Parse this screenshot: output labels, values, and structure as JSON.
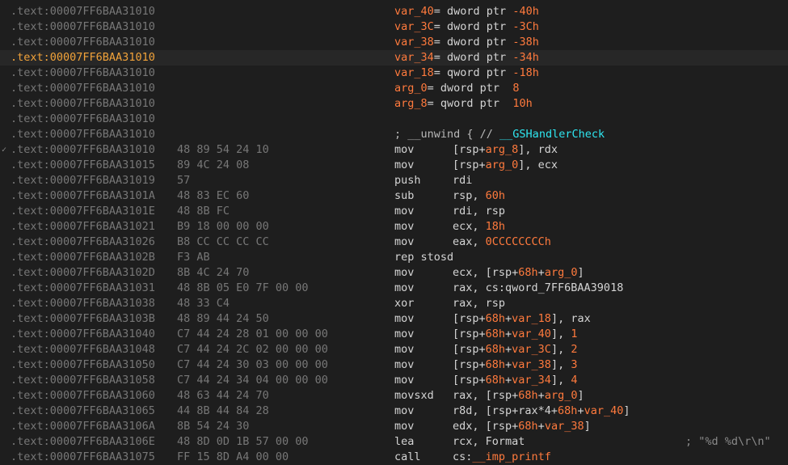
{
  "theme": {
    "background": "#1e1e1e",
    "highlight": "#f2a33a",
    "variable": "#ff7a3d",
    "function": "#2ee6f0"
  },
  "rows": [
    {
      "seg": ".text:",
      "addr": "00007FF6BAA31010",
      "bytes": "",
      "parts": [
        {
          "t": "var_40",
          "c": "var"
        },
        {
          "t": "= dword ptr ",
          "c": "kw"
        },
        {
          "t": "-40h",
          "c": "num"
        }
      ]
    },
    {
      "seg": ".text:",
      "addr": "00007FF6BAA31010",
      "bytes": "",
      "parts": [
        {
          "t": "var_3C",
          "c": "var"
        },
        {
          "t": "= dword ptr ",
          "c": "kw"
        },
        {
          "t": "-3Ch",
          "c": "num"
        }
      ]
    },
    {
      "seg": ".text:",
      "addr": "00007FF6BAA31010",
      "bytes": "",
      "parts": [
        {
          "t": "var_38",
          "c": "var"
        },
        {
          "t": "= dword ptr ",
          "c": "kw"
        },
        {
          "t": "-38h",
          "c": "num"
        }
      ]
    },
    {
      "seg": ".text:",
      "addr": "00007FF6BAA31010",
      "bytes": "",
      "hl": true,
      "parts": [
        {
          "t": "var_34",
          "c": "var"
        },
        {
          "t": "= dword ptr ",
          "c": "kw"
        },
        {
          "t": "-34h",
          "c": "num"
        }
      ]
    },
    {
      "seg": ".text:",
      "addr": "00007FF6BAA31010",
      "bytes": "",
      "parts": [
        {
          "t": "var_18",
          "c": "var"
        },
        {
          "t": "= qword ptr ",
          "c": "kw"
        },
        {
          "t": "-18h",
          "c": "num"
        }
      ]
    },
    {
      "seg": ".text:",
      "addr": "00007FF6BAA31010",
      "bytes": "",
      "parts": [
        {
          "t": "arg_0",
          "c": "var"
        },
        {
          "t": "= dword ptr  ",
          "c": "kw"
        },
        {
          "t": "8",
          "c": "num"
        }
      ]
    },
    {
      "seg": ".text:",
      "addr": "00007FF6BAA31010",
      "bytes": "",
      "parts": [
        {
          "t": "arg_8",
          "c": "var"
        },
        {
          "t": "= qword ptr  ",
          "c": "kw"
        },
        {
          "t": "10h",
          "c": "num"
        }
      ]
    },
    {
      "seg": ".text:",
      "addr": "00007FF6BAA31010",
      "bytes": "",
      "parts": []
    },
    {
      "seg": ".text:",
      "addr": "00007FF6BAA31010",
      "bytes": "",
      "parts": [
        {
          "t": "; __unwind { // ",
          "c": "cmt"
        },
        {
          "t": "__GSHandlerCheck",
          "c": "fn"
        }
      ]
    },
    {
      "seg": ".text:",
      "addr": "00007FF6BAA31010",
      "bytes": "48 89 54 24 10",
      "arrow": true,
      "mn": "mov",
      "op": [
        {
          "t": "[rsp+",
          "c": "kw"
        },
        {
          "t": "arg_8",
          "c": "var"
        },
        {
          "t": "], rdx",
          "c": "kw"
        }
      ]
    },
    {
      "seg": ".text:",
      "addr": "00007FF6BAA31015",
      "bytes": "89 4C 24 08",
      "mn": "mov",
      "op": [
        {
          "t": "[rsp+",
          "c": "kw"
        },
        {
          "t": "arg_0",
          "c": "var"
        },
        {
          "t": "], ecx",
          "c": "kw"
        }
      ]
    },
    {
      "seg": ".text:",
      "addr": "00007FF6BAA31019",
      "bytes": "57",
      "mn": "push",
      "op": [
        {
          "t": "rdi",
          "c": "kw"
        }
      ]
    },
    {
      "seg": ".text:",
      "addr": "00007FF6BAA3101A",
      "bytes": "48 83 EC 60",
      "mn": "sub",
      "op": [
        {
          "t": "rsp, ",
          "c": "kw"
        },
        {
          "t": "60h",
          "c": "num"
        }
      ]
    },
    {
      "seg": ".text:",
      "addr": "00007FF6BAA3101E",
      "bytes": "48 8B FC",
      "mn": "mov",
      "op": [
        {
          "t": "rdi, rsp",
          "c": "kw"
        }
      ]
    },
    {
      "seg": ".text:",
      "addr": "00007FF6BAA31021",
      "bytes": "B9 18 00 00 00",
      "mn": "mov",
      "op": [
        {
          "t": "ecx, ",
          "c": "kw"
        },
        {
          "t": "18h",
          "c": "num"
        }
      ]
    },
    {
      "seg": ".text:",
      "addr": "00007FF6BAA31026",
      "bytes": "B8 CC CC CC CC",
      "mn": "mov",
      "op": [
        {
          "t": "eax, ",
          "c": "kw"
        },
        {
          "t": "0CCCCCCCCh",
          "c": "num"
        }
      ]
    },
    {
      "seg": ".text:",
      "addr": "00007FF6BAA3102B",
      "bytes": "F3 AB",
      "mn": "rep stosd",
      "op": []
    },
    {
      "seg": ".text:",
      "addr": "00007FF6BAA3102D",
      "bytes": "8B 4C 24 70",
      "mn": "mov",
      "op": [
        {
          "t": "ecx, [rsp+",
          "c": "kw"
        },
        {
          "t": "68h",
          "c": "num"
        },
        {
          "t": "+",
          "c": "kw"
        },
        {
          "t": "arg_0",
          "c": "var"
        },
        {
          "t": "]",
          "c": "kw"
        }
      ]
    },
    {
      "seg": ".text:",
      "addr": "00007FF6BAA31031",
      "bytes": "48 8B 05 E0 7F 00 00",
      "mn": "mov",
      "op": [
        {
          "t": "rax, cs:qword_7FF6BAA39018",
          "c": "kw"
        }
      ]
    },
    {
      "seg": ".text:",
      "addr": "00007FF6BAA31038",
      "bytes": "48 33 C4",
      "mn": "xor",
      "op": [
        {
          "t": "rax, rsp",
          "c": "kw"
        }
      ]
    },
    {
      "seg": ".text:",
      "addr": "00007FF6BAA3103B",
      "bytes": "48 89 44 24 50",
      "mn": "mov",
      "op": [
        {
          "t": "[rsp+",
          "c": "kw"
        },
        {
          "t": "68h",
          "c": "num"
        },
        {
          "t": "+",
          "c": "kw"
        },
        {
          "t": "var_18",
          "c": "var"
        },
        {
          "t": "], rax",
          "c": "kw"
        }
      ]
    },
    {
      "seg": ".text:",
      "addr": "00007FF6BAA31040",
      "bytes": "C7 44 24 28 01 00 00 00",
      "mn": "mov",
      "op": [
        {
          "t": "[rsp+",
          "c": "kw"
        },
        {
          "t": "68h",
          "c": "num"
        },
        {
          "t": "+",
          "c": "kw"
        },
        {
          "t": "var_40",
          "c": "var"
        },
        {
          "t": "], ",
          "c": "kw"
        },
        {
          "t": "1",
          "c": "num"
        }
      ]
    },
    {
      "seg": ".text:",
      "addr": "00007FF6BAA31048",
      "bytes": "C7 44 24 2C 02 00 00 00",
      "mn": "mov",
      "op": [
        {
          "t": "[rsp+",
          "c": "kw"
        },
        {
          "t": "68h",
          "c": "num"
        },
        {
          "t": "+",
          "c": "kw"
        },
        {
          "t": "var_3C",
          "c": "var"
        },
        {
          "t": "], ",
          "c": "kw"
        },
        {
          "t": "2",
          "c": "num"
        }
      ]
    },
    {
      "seg": ".text:",
      "addr": "00007FF6BAA31050",
      "bytes": "C7 44 24 30 03 00 00 00",
      "mn": "mov",
      "op": [
        {
          "t": "[rsp+",
          "c": "kw"
        },
        {
          "t": "68h",
          "c": "num"
        },
        {
          "t": "+",
          "c": "kw"
        },
        {
          "t": "var_38",
          "c": "var"
        },
        {
          "t": "], ",
          "c": "kw"
        },
        {
          "t": "3",
          "c": "num"
        }
      ]
    },
    {
      "seg": ".text:",
      "addr": "00007FF6BAA31058",
      "bytes": "C7 44 24 34 04 00 00 00",
      "mn": "mov",
      "op": [
        {
          "t": "[rsp+",
          "c": "kw"
        },
        {
          "t": "68h",
          "c": "num"
        },
        {
          "t": "+",
          "c": "kw"
        },
        {
          "t": "var_34",
          "c": "var"
        },
        {
          "t": "], ",
          "c": "kw"
        },
        {
          "t": "4",
          "c": "num"
        }
      ]
    },
    {
      "seg": ".text:",
      "addr": "00007FF6BAA31060",
      "bytes": "48 63 44 24 70",
      "mn": "movsxd",
      "op": [
        {
          "t": "rax, [rsp+",
          "c": "kw"
        },
        {
          "t": "68h",
          "c": "num"
        },
        {
          "t": "+",
          "c": "kw"
        },
        {
          "t": "arg_0",
          "c": "var"
        },
        {
          "t": "]",
          "c": "kw"
        }
      ]
    },
    {
      "seg": ".text:",
      "addr": "00007FF6BAA31065",
      "bytes": "44 8B 44 84 28",
      "mn": "mov",
      "op": [
        {
          "t": "r8d, [rsp+rax*4+",
          "c": "kw"
        },
        {
          "t": "68h",
          "c": "num"
        },
        {
          "t": "+",
          "c": "kw"
        },
        {
          "t": "var_40",
          "c": "var"
        },
        {
          "t": "]",
          "c": "kw"
        }
      ]
    },
    {
      "seg": ".text:",
      "addr": "00007FF6BAA3106A",
      "bytes": "8B 54 24 30",
      "mn": "mov",
      "op": [
        {
          "t": "edx, [rsp+",
          "c": "kw"
        },
        {
          "t": "68h",
          "c": "num"
        },
        {
          "t": "+",
          "c": "kw"
        },
        {
          "t": "var_38",
          "c": "var"
        },
        {
          "t": "]",
          "c": "kw"
        }
      ]
    },
    {
      "seg": ".text:",
      "addr": "00007FF6BAA3106E",
      "bytes": "48 8D 0D 1B 57 00 00",
      "mn": "lea",
      "op": [
        {
          "t": "rcx, Format",
          "c": "kw"
        }
      ],
      "comment": "; \"%d %d\\r\\n\""
    },
    {
      "seg": ".text:",
      "addr": "00007FF6BAA31075",
      "bytes": "FF 15 8D A4 00 00",
      "mn": "call",
      "op": [
        {
          "t": "cs:",
          "c": "kw"
        },
        {
          "t": "__imp_printf",
          "c": "var"
        }
      ]
    }
  ]
}
